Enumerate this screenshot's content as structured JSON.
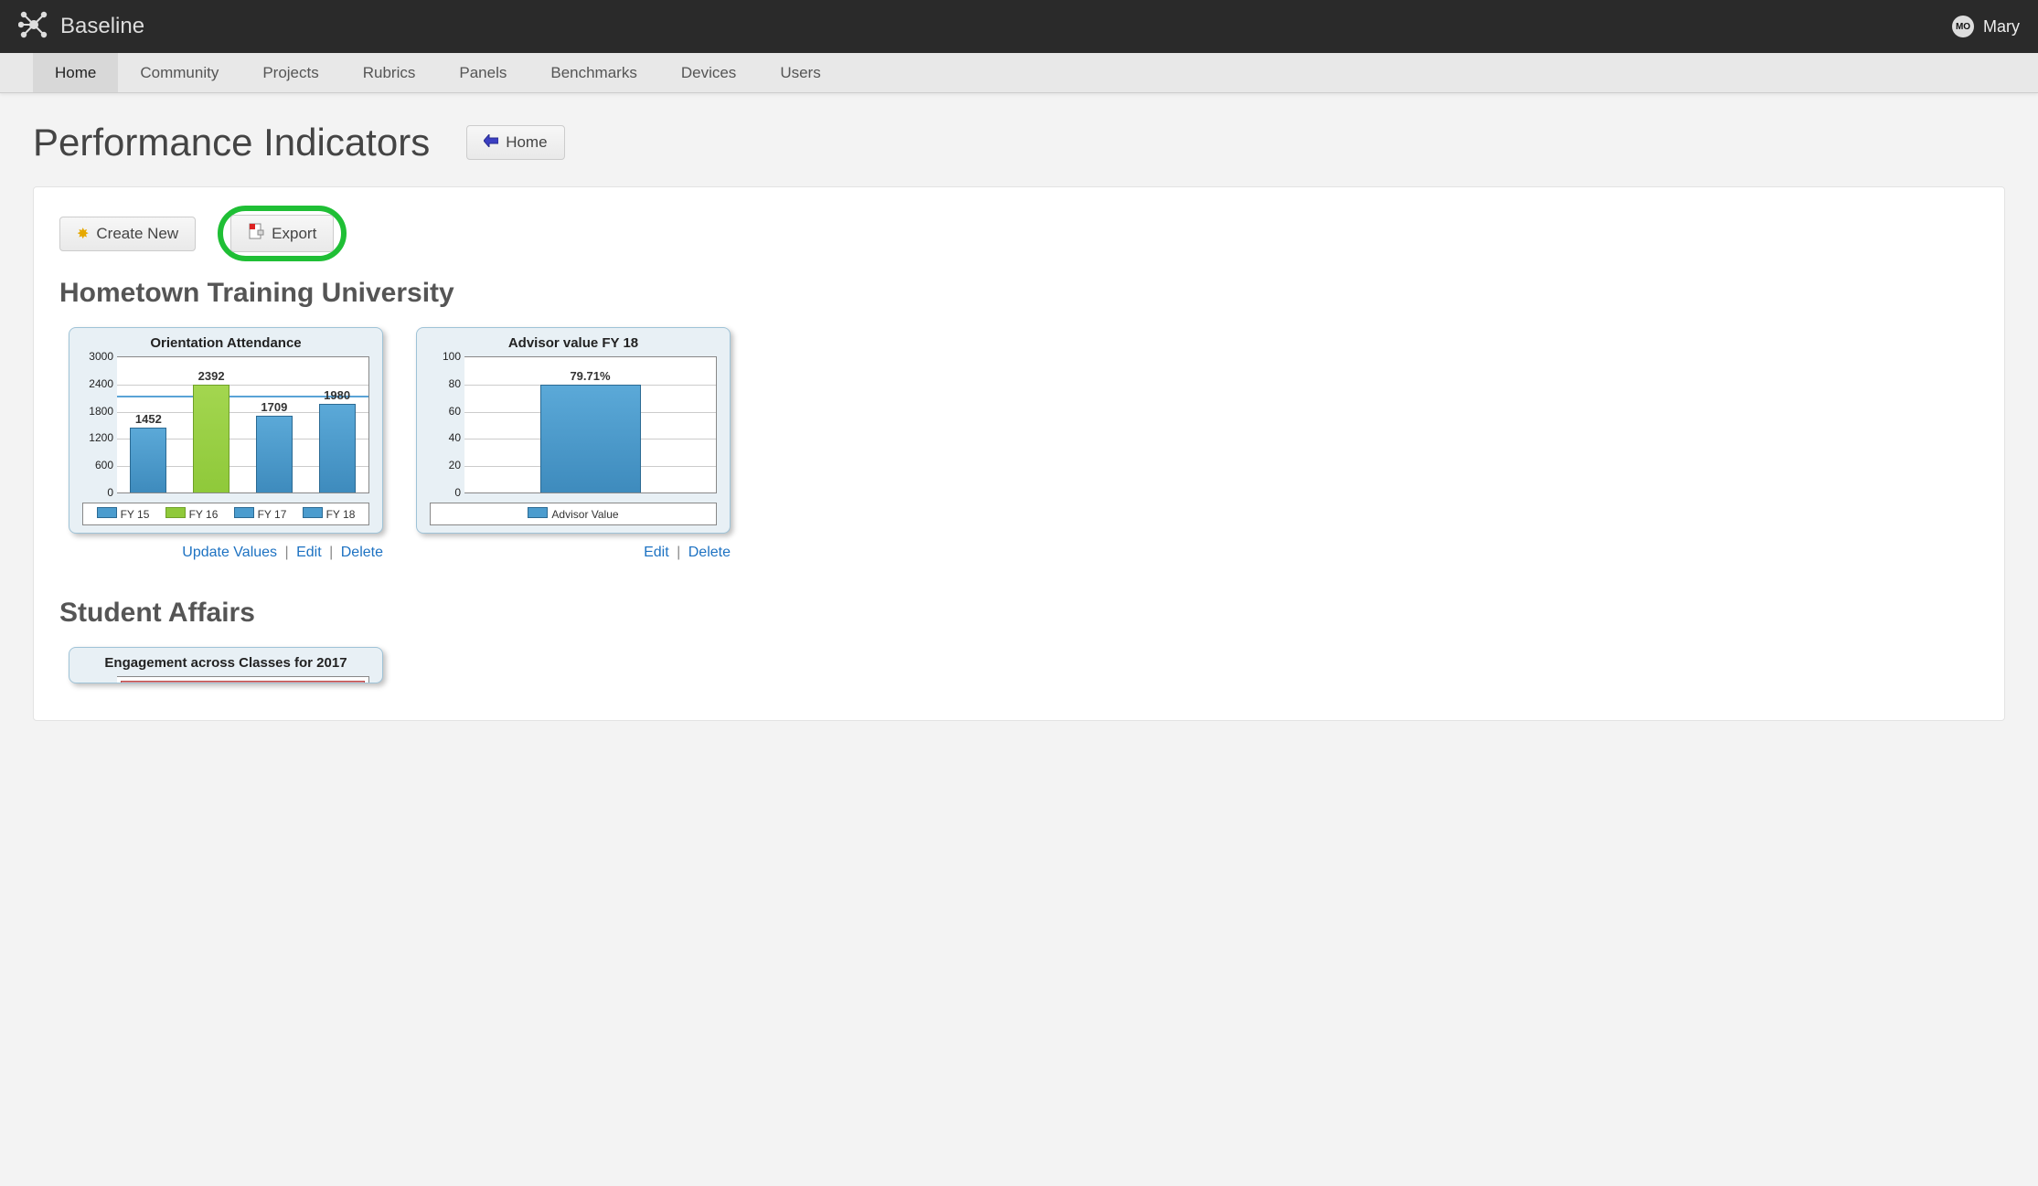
{
  "app": {
    "name": "Baseline"
  },
  "user": {
    "initials": "MO",
    "name": "Mary"
  },
  "nav": {
    "items": [
      {
        "label": "Home",
        "active": true
      },
      {
        "label": "Community",
        "active": false
      },
      {
        "label": "Projects",
        "active": false
      },
      {
        "label": "Rubrics",
        "active": false
      },
      {
        "label": "Panels",
        "active": false
      },
      {
        "label": "Benchmarks",
        "active": false
      },
      {
        "label": "Devices",
        "active": false
      },
      {
        "label": "Users",
        "active": false
      }
    ]
  },
  "page": {
    "title": "Performance Indicators",
    "home_label": "Home",
    "create_label": "Create New",
    "export_label": "Export"
  },
  "section1": {
    "title": "Hometown Training University"
  },
  "section2": {
    "title": "Student Affairs"
  },
  "card1": {
    "title": "Orientation Attendance",
    "actions": {
      "update": "Update Values",
      "edit": "Edit",
      "delete": "Delete"
    }
  },
  "card2": {
    "title": "Advisor value FY 18",
    "actions": {
      "edit": "Edit",
      "delete": "Delete"
    }
  },
  "card3": {
    "title": "Engagement across Classes for 2017"
  },
  "chart_data": [
    {
      "id": "orientation_attendance",
      "type": "bar",
      "title": "Orientation Attendance",
      "categories": [
        "FY 15",
        "FY 16",
        "FY 17",
        "FY 18"
      ],
      "values": [
        1452,
        2392,
        1709,
        1980
      ],
      "value_labels": [
        "1452",
        "2392",
        "1709",
        "1980"
      ],
      "colors": [
        "blue",
        "green",
        "blue",
        "blue"
      ],
      "ylim": [
        0,
        3000
      ],
      "y_ticks": [
        "3000",
        "2400",
        "1800",
        "1200",
        "600",
        "0"
      ],
      "target_line": 2150,
      "legend": [
        "FY 15",
        "FY 16",
        "FY 17",
        "FY 18"
      ],
      "legend_colors": [
        "blue",
        "green",
        "blue",
        "blue"
      ]
    },
    {
      "id": "advisor_value_fy18",
      "type": "bar",
      "title": "Advisor value FY 18",
      "categories": [
        "Advisor Value"
      ],
      "values": [
        79.71
      ],
      "value_labels": [
        "79.71%"
      ],
      "colors": [
        "blue"
      ],
      "ylim": [
        0,
        100
      ],
      "y_ticks": [
        "100",
        "80",
        "60",
        "40",
        "20",
        "0"
      ],
      "legend": [
        "Advisor Value"
      ],
      "legend_colors": [
        "blue"
      ]
    },
    {
      "id": "engagement_across_classes_2017",
      "type": "bar",
      "title": "Engagement across Classes for 2017"
    }
  ]
}
